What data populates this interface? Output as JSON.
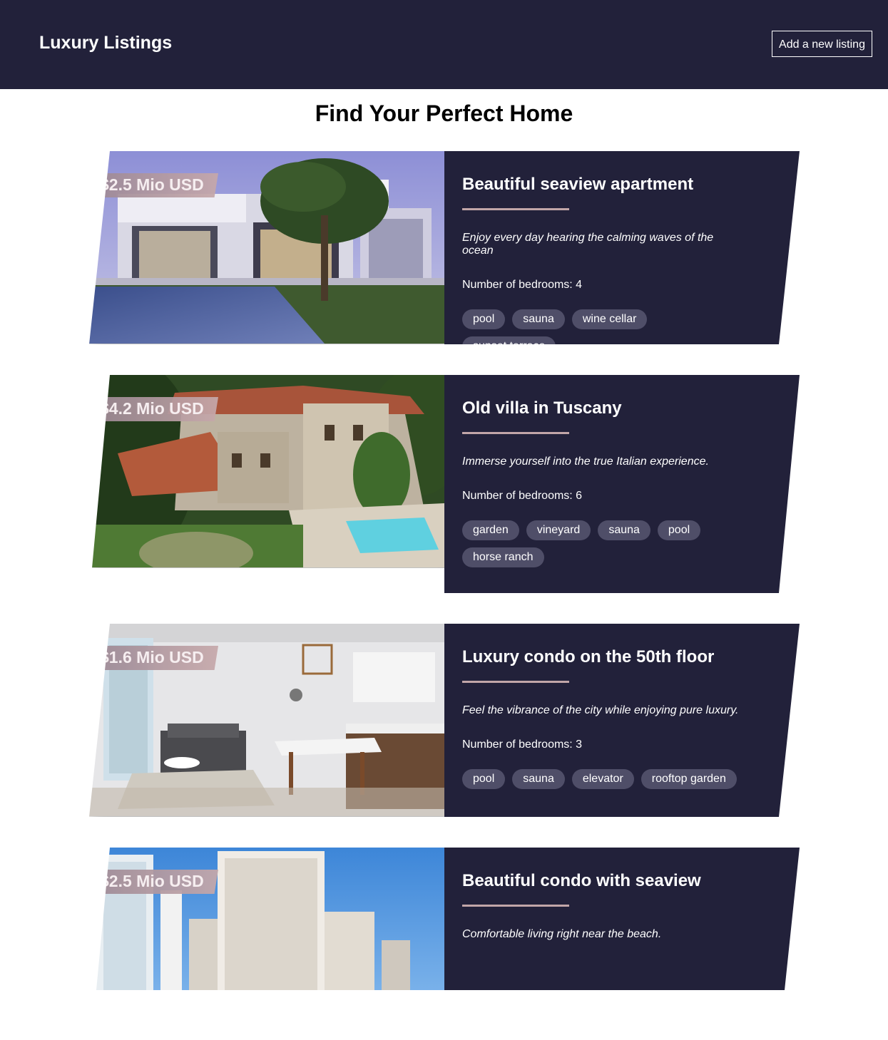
{
  "header": {
    "brand": "Luxury Listings",
    "add_button": "Add a new listing"
  },
  "main": {
    "title": "Find Your Perfect Home"
  },
  "listings": [
    {
      "price": "$2.5 Mio USD",
      "title": "Beautiful seaview apartment",
      "tagline": "Enjoy every day hearing the calming waves of the ocean",
      "bedrooms": "Number of bedrooms: 4",
      "features": [
        "pool",
        "sauna",
        "wine cellar",
        "sunset terrace"
      ],
      "photo": "modern-villa-with-pool-photo"
    },
    {
      "price": "$4.2 Mio USD",
      "title": "Old villa in Tuscany",
      "tagline": "Immerse yourself into the true Italian experience.",
      "bedrooms": "Number of bedrooms: 6",
      "features": [
        "garden",
        "vineyard",
        "sauna",
        "pool",
        "horse ranch"
      ],
      "photo": "stone-villa-aerial-photo"
    },
    {
      "price": "$1.6 Mio USD",
      "title": "Luxury condo on the 50th floor",
      "tagline": "Feel the vibrance of the city while enjoying pure luxury.",
      "bedrooms": "Number of bedrooms: 3",
      "features": [
        "pool",
        "sauna",
        "elevator",
        "rooftop garden"
      ],
      "photo": "condo-interior-photo"
    },
    {
      "price": "$2.5 Mio USD",
      "title": "Beautiful condo with seaview",
      "tagline": "Comfortable living right near the beach.",
      "photo": "high-rise-towers-photo"
    }
  ],
  "colors": {
    "header_bg": "#22213a",
    "card_bg": "#22213a",
    "feature_chip_bg": "#4f4e68",
    "accent_rule": "#c2a6a8"
  }
}
